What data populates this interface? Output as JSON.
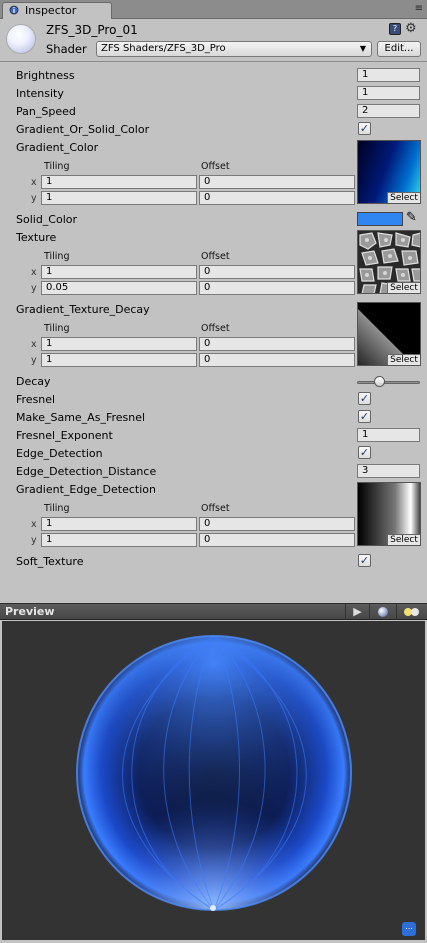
{
  "tab": {
    "label": "Inspector",
    "menu_icon": "≡"
  },
  "header": {
    "material_name": "ZFS_3D_Pro_01",
    "shader_label": "Shader",
    "shader_value": "ZFS Shaders/ZFS_3D_Pro",
    "edit_label": "Edit..."
  },
  "props": {
    "brightness": {
      "label": "Brightness",
      "value": "1"
    },
    "intensity": {
      "label": "Intensity",
      "value": "1"
    },
    "pan_speed": {
      "label": "Pan_Speed",
      "value": "2"
    },
    "gradient_or_solid": {
      "label": "Gradient_Or_Solid_Color",
      "checked": true
    },
    "gradient_color": {
      "label": "Gradient_Color",
      "tiling_x": "1",
      "tiling_y": "1",
      "offset_x": "0",
      "offset_y": "0"
    },
    "solid_color": {
      "label": "Solid_Color",
      "color": "#2f86f0"
    },
    "texture": {
      "label": "Texture",
      "tiling_x": "1",
      "tiling_y": "0.05",
      "offset_x": "0",
      "offset_y": "0"
    },
    "gradient_texture_decay": {
      "label": "Gradient_Texture_Decay",
      "tiling_x": "1",
      "tiling_y": "1",
      "offset_x": "0",
      "offset_y": "0"
    },
    "decay": {
      "label": "Decay",
      "fraction": 0.33
    },
    "fresnel": {
      "label": "Fresnel",
      "checked": true
    },
    "make_same": {
      "label": "Make_Same_As_Fresnel",
      "checked": true
    },
    "fresnel_exponent": {
      "label": "Fresnel_Exponent",
      "value": "1"
    },
    "edge_detection": {
      "label": "Edge_Detection",
      "checked": true
    },
    "edge_distance": {
      "label": "Edge_Detection_Distance",
      "value": "3"
    },
    "gradient_edge": {
      "label": "Gradient_Edge_Detection",
      "tiling_x": "1",
      "tiling_y": "1",
      "offset_x": "0",
      "offset_y": "0"
    },
    "soft_texture": {
      "label": "Soft_Texture",
      "checked": true
    }
  },
  "common": {
    "tiling": "Tiling",
    "offset": "Offset",
    "x": "x",
    "y": "y",
    "select": "Select",
    "check": "✓"
  },
  "preview": {
    "title": "Preview",
    "play": "▶"
  },
  "colors": {
    "panel": "#c2c2c2",
    "preview_bg": "#333333",
    "glow": "#2f6bff"
  }
}
